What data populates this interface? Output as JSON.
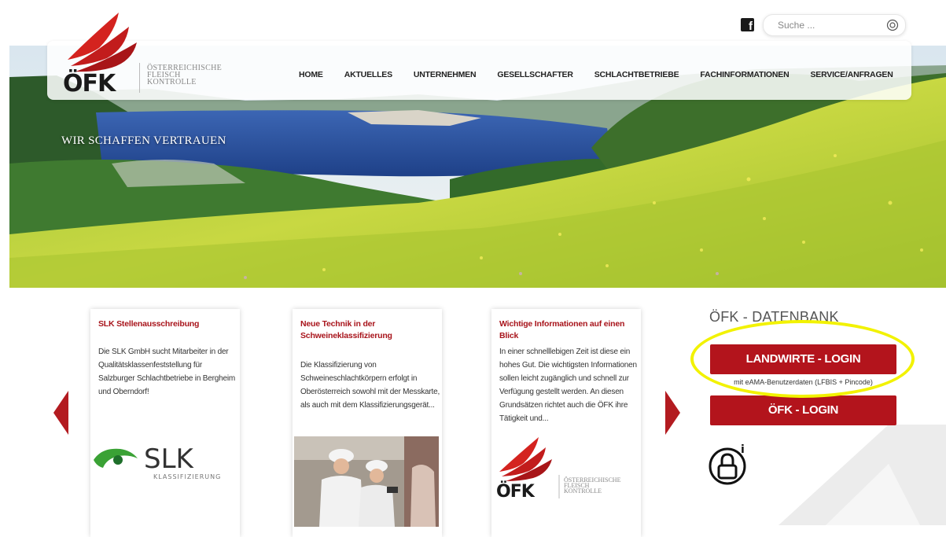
{
  "header": {
    "brand": "ÖFK",
    "brand_sub_line1": "ÖSTERREICHISCHE",
    "brand_sub_line2": "FLEISCH",
    "brand_sub_line3": "KONTROLLE",
    "search_placeholder": "Suche ...",
    "nav": [
      "HOME",
      "AKTUELLES",
      "UNTERNEHMEN",
      "GESELLSCHAFTER",
      "SCHLACHTBETRIEBE",
      "FACHINFORMATIONEN",
      "SERVICE/ANFRAGEN"
    ]
  },
  "hero": {
    "slogan": "WIR SCHAFFEN VERTRAUEN"
  },
  "cards": [
    {
      "title": "SLK Stellenausschreibung",
      "text": "Die SLK GmbH sucht Mitarbeiter in der Qualitätsklassenfeststellung für Salzburger Schlachtbetriebe in Bergheim und Oberndorf!",
      "logo_main": "SLK",
      "logo_sub": "KLASSIFIZIERUNG"
    },
    {
      "title": "Neue Technik in der Schweineklassifizierung",
      "text": "Die Klassifizierung von Schweineschlachtkörpern erfolgt in Oberösterreich sowohl mit der Messkarte, als auch mit dem Klassifizierungsgerät..."
    },
    {
      "title": "Wichtige Informationen auf einen Blick",
      "text": "In einer schnelllebigen Zeit ist diese ein hohes Gut. Die wichtigsten Informationen sollen leicht zugänglich und schnell zur Verfügung gestellt werden. An diesen Grundsätzen richtet auch die ÖFK ihre Tätigkeit und...",
      "logo_main": "ÖFK",
      "logo_sub_line1": "ÖSTERREICHISCHE",
      "logo_sub_line2": "FLEISCH",
      "logo_sub_line3": "KONTROLLE"
    }
  ],
  "database": {
    "title": "ÖFK - DATENBANK",
    "landwirte_login": "LANDWIRTE - LOGIN",
    "landwirte_sub": "mit eAMA-Benutzerdaten (LFBIS + Pincode)",
    "oefk_login": "ÖFK - LOGIN",
    "lock_badge": "i"
  },
  "colors": {
    "brand_red": "#b3141c",
    "highlight": "#f2f200"
  }
}
